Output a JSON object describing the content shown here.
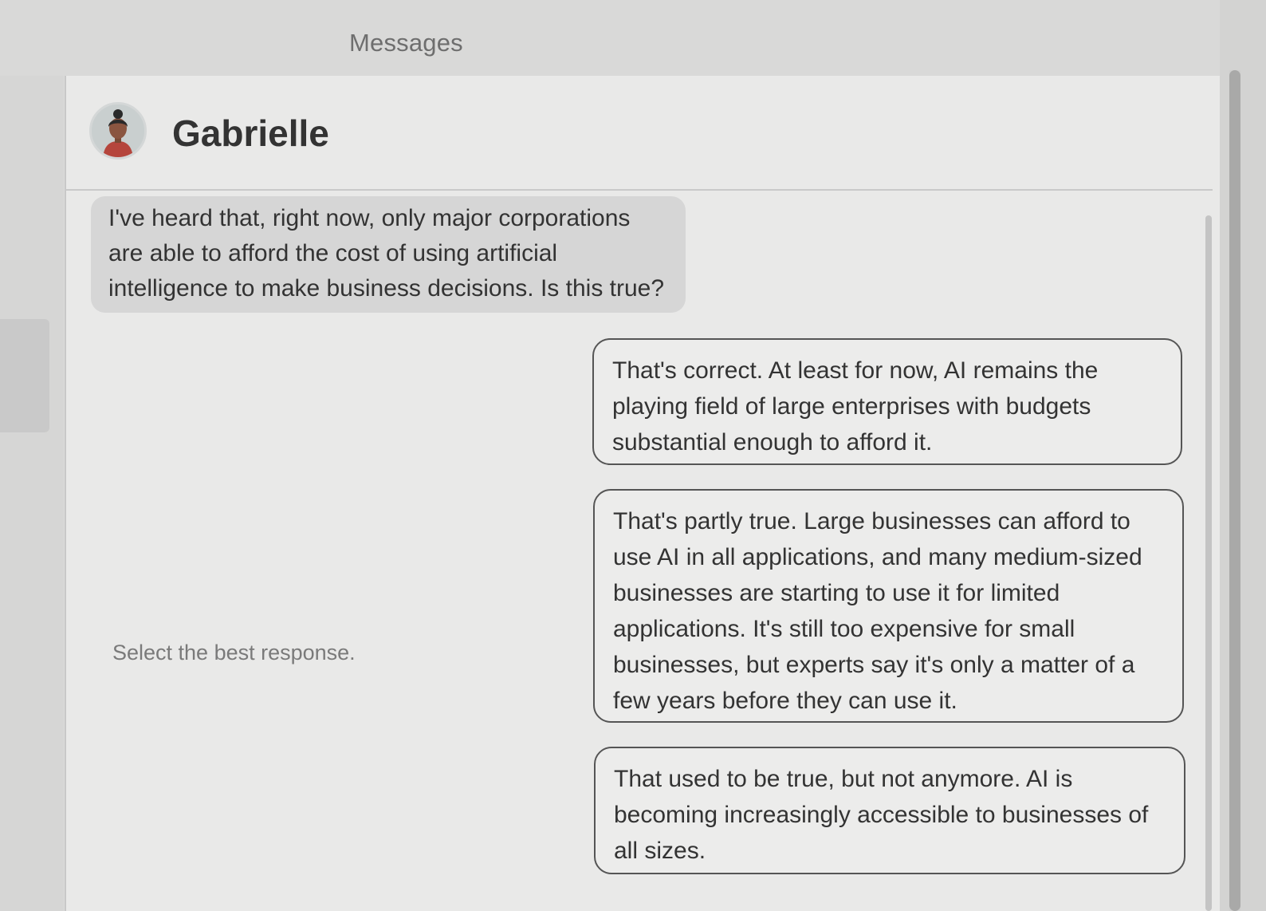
{
  "window": {
    "title": "Messages"
  },
  "conversation": {
    "contact_name": "Gabrielle",
    "avatar_icon": "person-avatar-icon",
    "incoming_message": "I've heard that, right now, only major corporations are able to afford the cost of using artificial intelligence to make business decisions. Is this true?"
  },
  "response_prompt": "Select the best response.",
  "options": [
    {
      "text": "That's correct. At least for now, AI remains the playing field of large enterprises with budgets substantial enough to afford it."
    },
    {
      "text": "That's partly true. Large businesses can afford to use AI in all applications, and many medium-sized businesses are starting to use it for limited applications. It's still too expensive for small businesses, but experts say it's only a matter of a few years before they can use it."
    },
    {
      "text": "That used to be true, but not anymore. AI is becoming increasingly accessible to businesses of all sizes."
    }
  ],
  "colors": {
    "panel_background": "#e9e9e8",
    "incoming_bubble": "#d6d6d6",
    "option_border": "#555555",
    "text": "#333333"
  }
}
